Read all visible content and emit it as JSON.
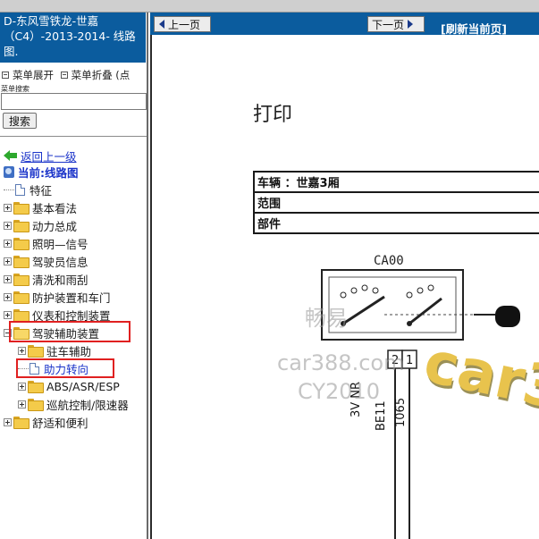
{
  "left_pane": {
    "title": "D-东风雪铁龙-世嘉（C4）-2013-2014- 线路图.",
    "menu_expand": "菜单展开",
    "menu_collapse": "菜单折叠 (点",
    "search_label": "菜单搜索",
    "search_value": "",
    "search_button": "搜索",
    "back_link": "返回上一级",
    "current": "当前:线路图",
    "tree": [
      {
        "label": "特征",
        "kind": "doc"
      },
      {
        "label": "基本看法",
        "kind": "folder"
      },
      {
        "label": "动力总成",
        "kind": "folder"
      },
      {
        "label": "照明—信号",
        "kind": "folder"
      },
      {
        "label": "驾驶员信息",
        "kind": "folder"
      },
      {
        "label": "清洗和雨刮",
        "kind": "folder"
      },
      {
        "label": "防护装置和车门",
        "kind": "folder"
      },
      {
        "label": "仪表和控制装置",
        "kind": "folder"
      },
      {
        "label": "驾驶辅助装置",
        "kind": "folder-open",
        "highlight": true
      },
      {
        "label": "驻车辅助",
        "kind": "child-folder"
      },
      {
        "label": "助力转向",
        "kind": "child-doc",
        "highlight": true
      },
      {
        "label": "ABS/ASR/ESP",
        "kind": "child-folder"
      },
      {
        "label": "巡航控制/限速器",
        "kind": "child-folder"
      },
      {
        "label": "舒适和便利",
        "kind": "folder"
      }
    ]
  },
  "nav": {
    "prev": "上一页",
    "next": "下一页",
    "refresh": "[刷新当前页]"
  },
  "document": {
    "title": "打印",
    "vehicle": "车辆 ：世嘉3厢",
    "scope": "范围",
    "part": "部件",
    "connector": "CA00",
    "pin_2": "2",
    "pin_1": "1",
    "wire_label_1": "3V NR",
    "wire_label_2": "BE11",
    "wire_label_3": "1065"
  },
  "watermark": {
    "line1": "畅易",
    "line2": "car388.com",
    "line3": "CY2010",
    "big": "car3"
  },
  "colors": {
    "title_bg": "#0b5c9e",
    "link": "#1a33c9",
    "highlight": "#e02020",
    "folder": "#f4cb4a"
  }
}
